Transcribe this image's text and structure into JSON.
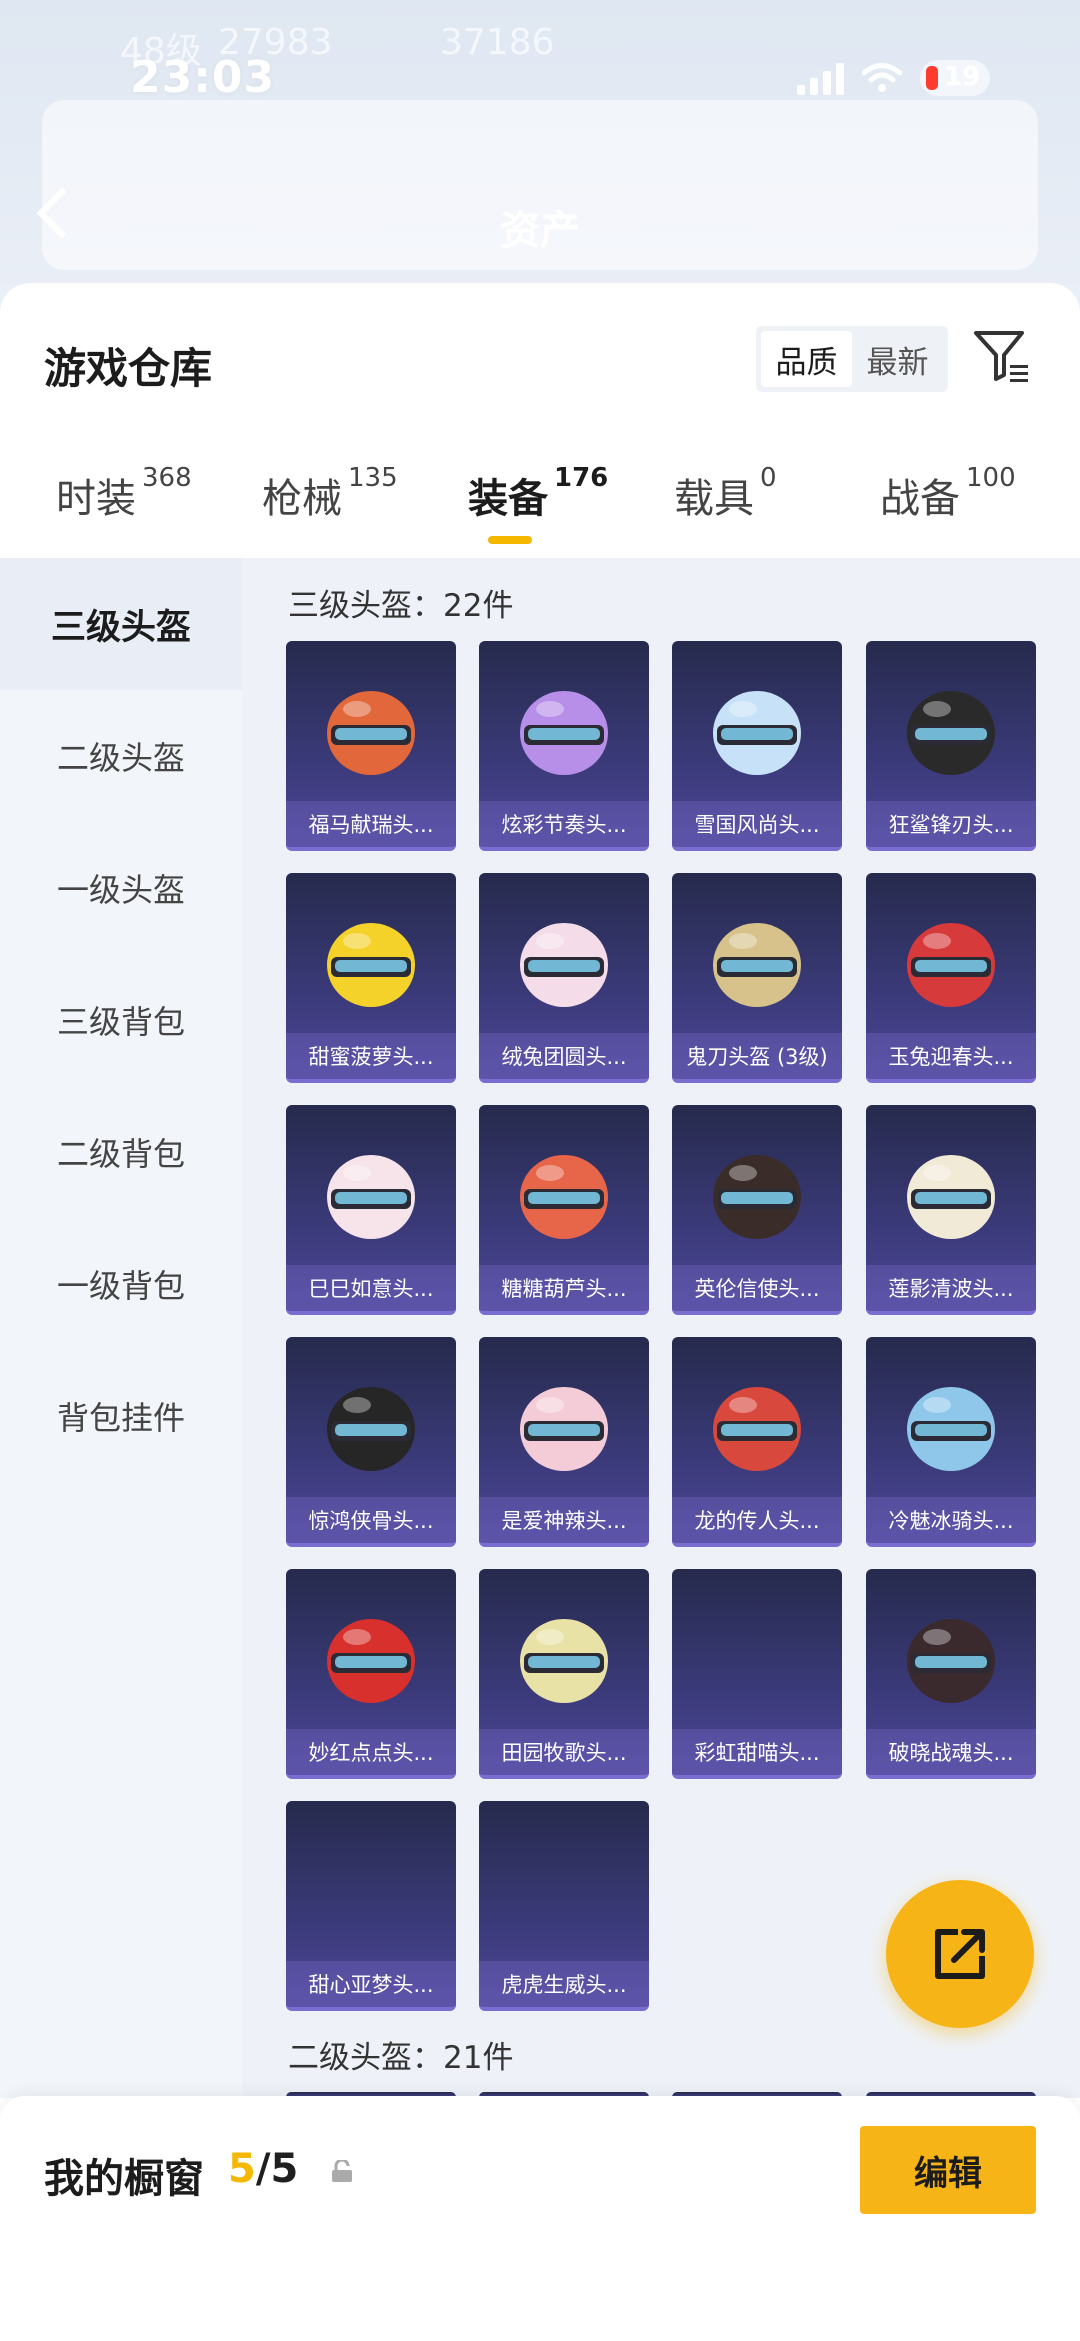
{
  "status_bar": {
    "time": "23:03",
    "faint_left": "48级",
    "faint_left2": "27983",
    "faint_right": "37186",
    "battery": "19"
  },
  "header": {
    "title": "资产"
  },
  "sheet": {
    "title": "游戏仓库",
    "sort": {
      "quality": "品质",
      "latest": "最新"
    }
  },
  "tabs": [
    {
      "label": "时装",
      "count": "368"
    },
    {
      "label": "枪械",
      "count": "135"
    },
    {
      "label": "装备",
      "count": "176"
    },
    {
      "label": "载具",
      "count": "0"
    },
    {
      "label": "战备",
      "count": "100"
    }
  ],
  "sidebar": [
    {
      "label": "三级头盔"
    },
    {
      "label": "二级头盔"
    },
    {
      "label": "一级头盔"
    },
    {
      "label": "三级背包"
    },
    {
      "label": "二级背包"
    },
    {
      "label": "一级背包"
    },
    {
      "label": "背包挂件"
    }
  ],
  "sections": {
    "level3": "三级头盔：22件",
    "level2": "二级头盔：21件"
  },
  "items": [
    {
      "name": "福马献瑞头...",
      "color": "#e2673a"
    },
    {
      "name": "炫彩节奏头...",
      "color": "#b78ee8"
    },
    {
      "name": "雪国风尚头...",
      "color": "#c7e2f8"
    },
    {
      "name": "狂鲨锋刃头...",
      "color": "#2a2a2a"
    },
    {
      "name": "甜蜜菠萝头...",
      "color": "#f4d22a"
    },
    {
      "name": "绒兔团圆头...",
      "color": "#f4dde8"
    },
    {
      "name": "鬼刀头盔 (3级)",
      "color": "#d6c28a"
    },
    {
      "name": "玉兔迎春头...",
      "color": "#d63a3a"
    },
    {
      "name": "巳巳如意头...",
      "color": "#f6e4ea"
    },
    {
      "name": "糖糖葫芦头...",
      "color": "#e7664a"
    },
    {
      "name": "英伦信使头...",
      "color": "#3a2c28"
    },
    {
      "name": "莲影清波头...",
      "color": "#f1ead6"
    },
    {
      "name": "惊鸿侠骨头...",
      "color": "#262626"
    },
    {
      "name": "是爱神辣头...",
      "color": "#f4ccd8"
    },
    {
      "name": "龙的传人头...",
      "color": "#d8483c"
    },
    {
      "name": "冷魅冰骑头...",
      "color": "#8fc7ea"
    },
    {
      "name": "妙红点点头...",
      "color": "#d8302c"
    },
    {
      "name": "田园牧歌头...",
      "color": "#e9e2a6"
    },
    {
      "name": "彩虹甜喵头...",
      "color": ""
    },
    {
      "name": "破晓战魂头...",
      "color": "#3a2a2e"
    },
    {
      "name": "甜心亚梦头...",
      "color": ""
    },
    {
      "name": "虎虎生威头...",
      "color": ""
    }
  ],
  "bottom": {
    "title": "我的橱窗",
    "current": "5",
    "total": "/5",
    "edit": "编辑"
  }
}
